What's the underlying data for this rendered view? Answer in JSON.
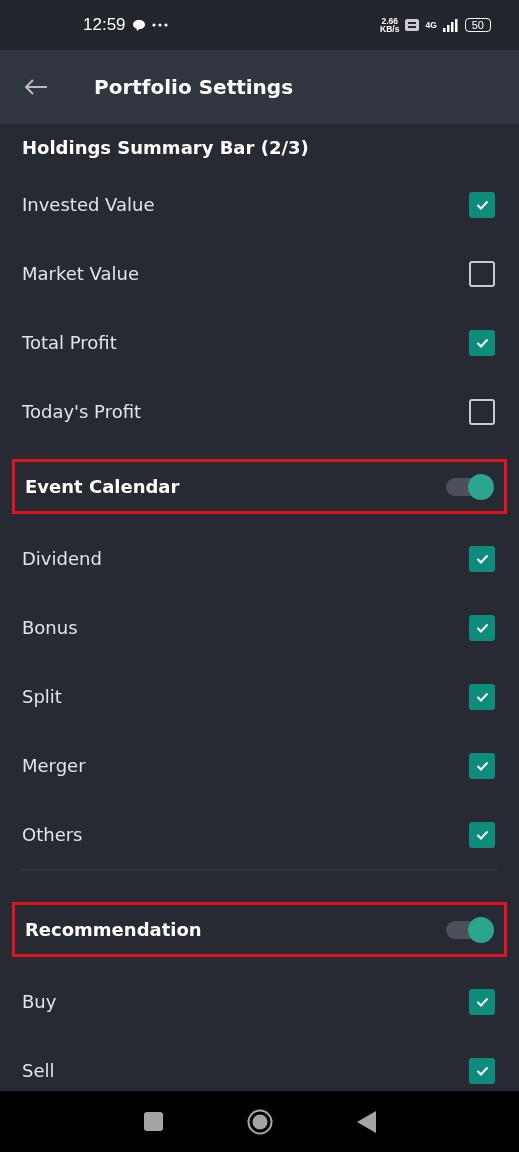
{
  "status_bar": {
    "time": "12:59",
    "speed": "2.66",
    "speed_unit": "KB/s",
    "network": "4G",
    "battery": "50"
  },
  "app_bar": {
    "title": "Portfolio Settings"
  },
  "sections": [
    {
      "title": "Holdings Summary Bar (2/3)",
      "kind": "plain",
      "highlighted": false,
      "divider_before": false,
      "items": [
        {
          "label": "Invested Value",
          "checked": true
        },
        {
          "label": "Market Value",
          "checked": false
        },
        {
          "label": "Total Profit",
          "checked": true
        },
        {
          "label": "Today's Profit",
          "checked": false
        }
      ]
    },
    {
      "title": "Event Calendar",
      "kind": "toggle",
      "on": true,
      "highlighted": true,
      "divider_before": false,
      "items": [
        {
          "label": "Dividend",
          "checked": true
        },
        {
          "label": "Bonus",
          "checked": true
        },
        {
          "label": "Split",
          "checked": true
        },
        {
          "label": "Merger",
          "checked": true
        },
        {
          "label": "Others",
          "checked": true
        }
      ]
    },
    {
      "title": "Recommendation",
      "kind": "toggle",
      "on": true,
      "highlighted": true,
      "divider_before": true,
      "items": [
        {
          "label": "Buy",
          "checked": true
        },
        {
          "label": "Sell",
          "checked": true
        }
      ]
    }
  ]
}
